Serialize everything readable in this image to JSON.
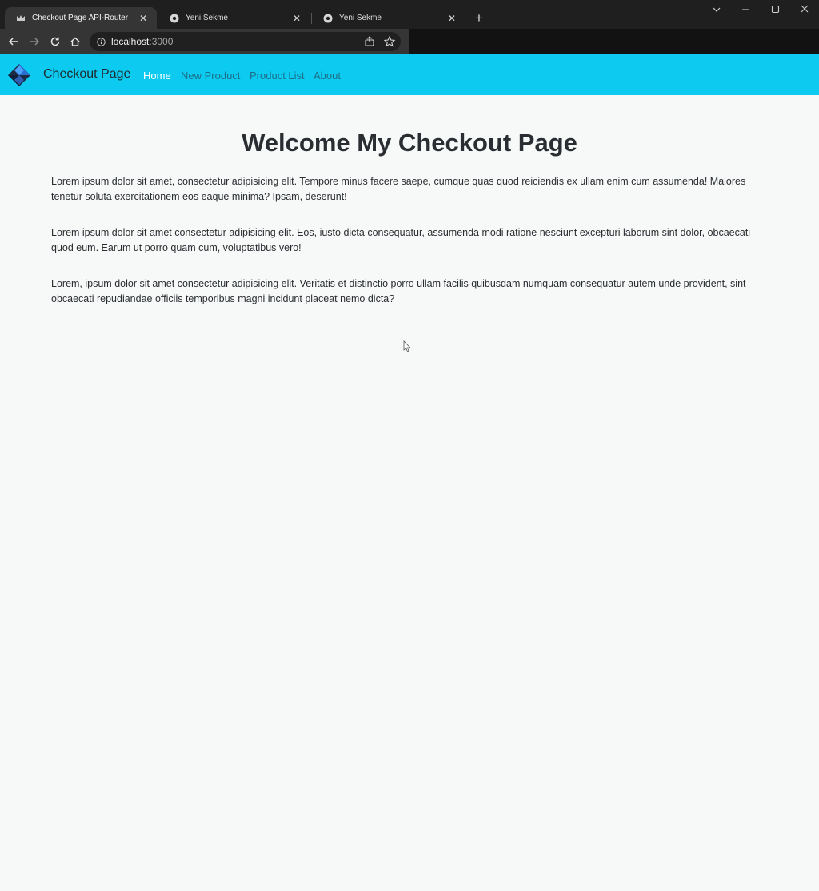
{
  "browser": {
    "tabs": [
      {
        "title": "Checkout Page API-Router",
        "icon": "crown-icon",
        "active": true
      },
      {
        "title": "Yeni Sekme",
        "icon": "chrome-icon",
        "active": false
      },
      {
        "title": "Yeni Sekme",
        "icon": "chrome-icon",
        "active": false
      }
    ],
    "new_tab_label": "+",
    "url_host": "localhost",
    "url_port": ":3000"
  },
  "navbar": {
    "brand": "Checkout Page",
    "links": [
      {
        "label": "Home",
        "active": true
      },
      {
        "label": "New Product",
        "active": false
      },
      {
        "label": "Product List",
        "active": false
      },
      {
        "label": "About",
        "active": false
      }
    ],
    "color": "#0dcaf0"
  },
  "main": {
    "title": "Welcome My Checkout Page",
    "paragraphs": [
      "Lorem ipsum dolor sit amet, consectetur adipisicing elit. Tempore minus facere saepe, cumque quas quod reiciendis ex ullam enim cum assumenda! Maiores tenetur soluta exercitationem eos eaque minima? Ipsam, deserunt!",
      "Lorem ipsum dolor sit amet consectetur adipisicing elit. Eos, iusto dicta consequatur, assumenda modi ratione nesciunt excepturi laborum sint dolor, obcaecati quod eum. Earum ut porro quam cum, voluptatibus vero!",
      "Lorem, ipsum dolor sit amet consectetur adipisicing elit. Veritatis et distinctio porro ullam facilis quibusdam numquam consequatur autem unde provident, sint obcaecati repudiandae officiis temporibus magni incidunt placeat nemo dicta?"
    ]
  }
}
